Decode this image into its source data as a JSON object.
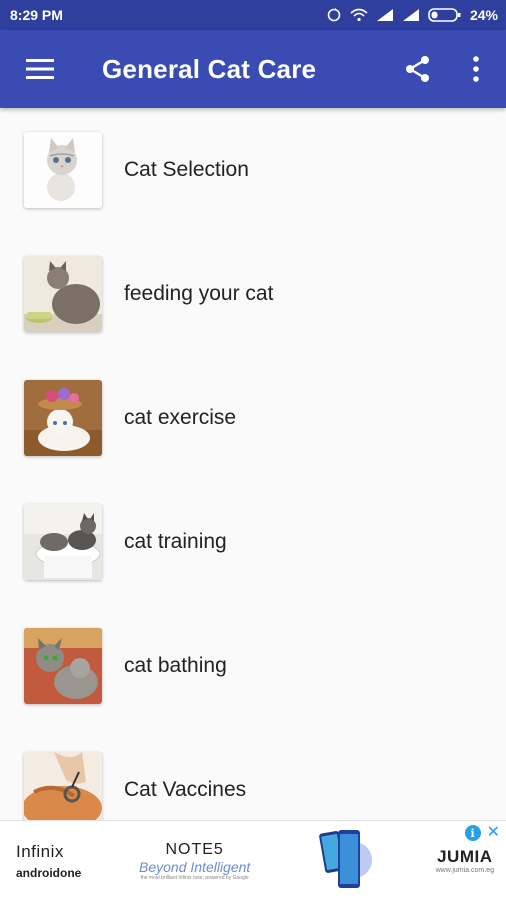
{
  "status_bar": {
    "time": "8:29 PM",
    "battery": "24%"
  },
  "app_bar": {
    "title": "General Cat Care",
    "menu_icon": "hamburger-menu-icon",
    "share_icon": "share-icon",
    "overflow_icon": "more-vert-icon"
  },
  "list": {
    "items": [
      {
        "label": "Cat Selection"
      },
      {
        "label": "feeding your cat"
      },
      {
        "label": "cat exercise"
      },
      {
        "label": "cat training"
      },
      {
        "label": "cat bathing"
      },
      {
        "label": "Cat Vaccines"
      }
    ]
  },
  "ad": {
    "brand_top": "Infinix",
    "brand_bottom": "androidone",
    "note_title": "NOTE5",
    "note_tagline": "Beyond Intelligent",
    "note_small": "the most brilliant Infinix note, powered by Google",
    "shop_name": "JUMIA",
    "shop_url": "www.jumia.com.eg"
  },
  "colors": {
    "status_bar": "#2f3f9e",
    "app_bar": "#3a4cb3",
    "background": "#fafafa",
    "ad_accent": "#26a0e8"
  }
}
